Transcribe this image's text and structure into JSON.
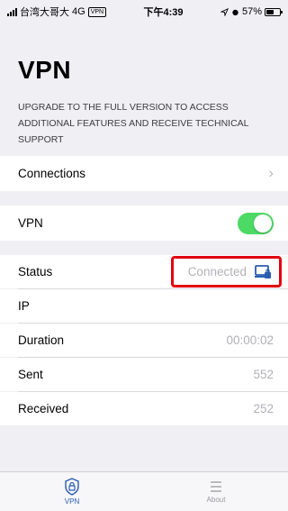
{
  "status_bar": {
    "carrier": "台湾大哥大",
    "network": "4G",
    "vpn_badge": "VPN",
    "time": "下午4:39",
    "battery": "57%",
    "battery_level": 0.57
  },
  "page": {
    "title": "VPN",
    "upgrade_text": "UPGRADE TO THE FULL VERSION TO ACCESS ADDITIONAL FEATURES AND RECEIVE TECHNICAL SUPPORT"
  },
  "connections": {
    "label": "Connections"
  },
  "vpn_toggle": {
    "label": "VPN",
    "on": true
  },
  "details": {
    "status_label": "Status",
    "status_value": "Connected",
    "ip_label": "IP",
    "ip_value": "",
    "duration_label": "Duration",
    "duration_value": "00:00:02",
    "sent_label": "Sent",
    "sent_value": "552",
    "received_label": "Received",
    "received_value": "252"
  },
  "tabs": [
    {
      "label": "VPN",
      "icon": "lock-shield-icon",
      "active": true
    },
    {
      "label": "About",
      "icon": "list-icon",
      "active": false
    }
  ],
  "colors": {
    "toggle_on": "#4cd964",
    "highlight": "#e3000f",
    "active_tab": "#2a5db0"
  }
}
